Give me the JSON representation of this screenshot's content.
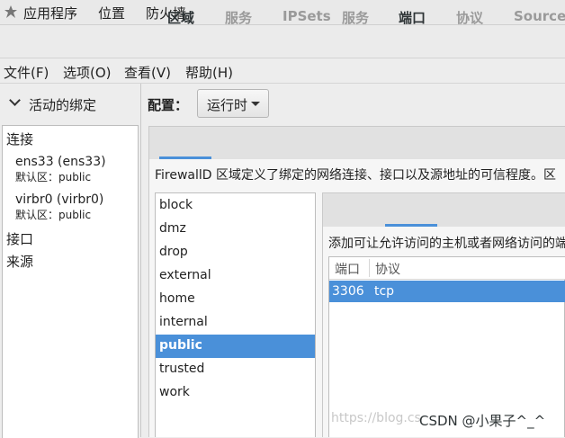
{
  "topbar": {
    "apps": "应用程序",
    "places": "位置",
    "window_title": "防火墙"
  },
  "menu": {
    "file": "文件(F)",
    "options": "选项(O)",
    "view": "查看(V)",
    "help": "帮助(H)"
  },
  "left": {
    "header": "活动的绑定",
    "connections_label": "连接",
    "connections": [
      {
        "name": "ens33 (ens33)",
        "zone": "默认区：public"
      },
      {
        "name": "virbr0 (virbr0)",
        "zone": "默认区：public"
      }
    ],
    "interfaces_label": "接口",
    "sources_label": "来源"
  },
  "config": {
    "label": "配置：",
    "mode": "运行时"
  },
  "outer_tabs": {
    "zone": "区域",
    "services": "服务",
    "ipsets": "IPSets"
  },
  "zone_desc": "FirewallD 区域定义了绑定的网络连接、接口以及源地址的可信程度。区",
  "zones": [
    "block",
    "dmz",
    "drop",
    "external",
    "home",
    "internal",
    "public",
    "trusted",
    "work"
  ],
  "selected_zone": "public",
  "inner_tabs": {
    "services": "服务",
    "ports": "端口",
    "protocols": "协议",
    "source_ports": "Source Port"
  },
  "ports_desc": "添加可让允许访问的主机或者网络访问的端口",
  "ports_table": {
    "headers": {
      "port": "端口",
      "protocol": "协议"
    },
    "rows": [
      {
        "port": "3306",
        "protocol": "tcp"
      }
    ]
  },
  "watermark": {
    "url": "https://blog.cs",
    "author": "CSDN @小果子^_^"
  },
  "colors": {
    "accent": "#4a90d9",
    "background": "#ededed"
  }
}
